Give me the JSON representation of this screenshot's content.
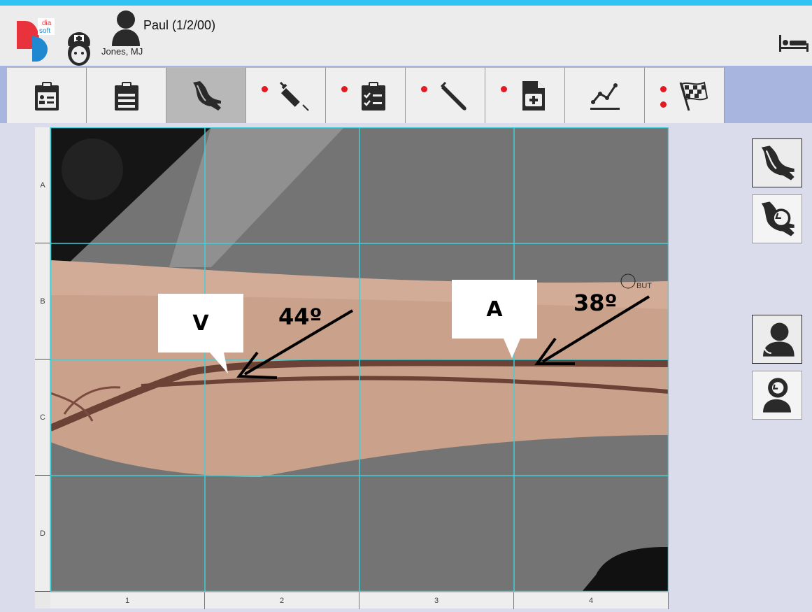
{
  "header": {
    "logo_top": "dia",
    "logo_bottom": "soft",
    "patient_name": "Paul (1/2/00)",
    "doctor_name": "Jones, MJ"
  },
  "tabs": [
    {
      "name": "tab-patient-card",
      "icon": "clipboard-id-icon",
      "alert": false,
      "active": false
    },
    {
      "name": "tab-notes",
      "icon": "clipboard-lines-icon",
      "alert": false,
      "active": false
    },
    {
      "name": "tab-vascular-access",
      "icon": "arm-vessel-icon",
      "alert": false,
      "active": true
    },
    {
      "name": "tab-medication",
      "icon": "syringe-icon",
      "alert": true,
      "active": false
    },
    {
      "name": "tab-checklist",
      "icon": "clipboard-check-icon",
      "alert": true,
      "active": false
    },
    {
      "name": "tab-lab",
      "icon": "test-tube-icon",
      "alert": true,
      "active": false
    },
    {
      "name": "tab-documents",
      "icon": "medical-document-icon",
      "alert": true,
      "active": false
    },
    {
      "name": "tab-trends",
      "icon": "line-chart-icon",
      "alert": false,
      "active": false
    },
    {
      "name": "tab-finish",
      "icon": "checkered-flag-icon",
      "alert": true,
      "double_alert": true,
      "active": false
    }
  ],
  "grid": {
    "rows": [
      "A",
      "B",
      "C",
      "D"
    ],
    "columns": [
      "1",
      "2",
      "3",
      "4"
    ]
  },
  "annotations": {
    "venous_label": "V",
    "venous_angle": "44º",
    "arterial_label": "A",
    "arterial_angle": "38º",
    "but_label": "BUT"
  },
  "side_buttons": [
    {
      "name": "arm-view-button",
      "icon": "arm-vessel-icon"
    },
    {
      "name": "arm-rotate-button",
      "icon": "arm-rotate-icon"
    },
    {
      "name": "patient-view-button",
      "icon": "patient-bust-icon"
    },
    {
      "name": "patient-rotate-button",
      "icon": "patient-rotate-icon"
    }
  ],
  "colors": {
    "top_accent": "#2fc4f4",
    "tab_bar_bg": "#a7b5df",
    "alert_dot": "#e21b22",
    "grid_line": "#40d0d8",
    "logo_red": "#e8323c",
    "logo_blue": "#1e88d0"
  }
}
